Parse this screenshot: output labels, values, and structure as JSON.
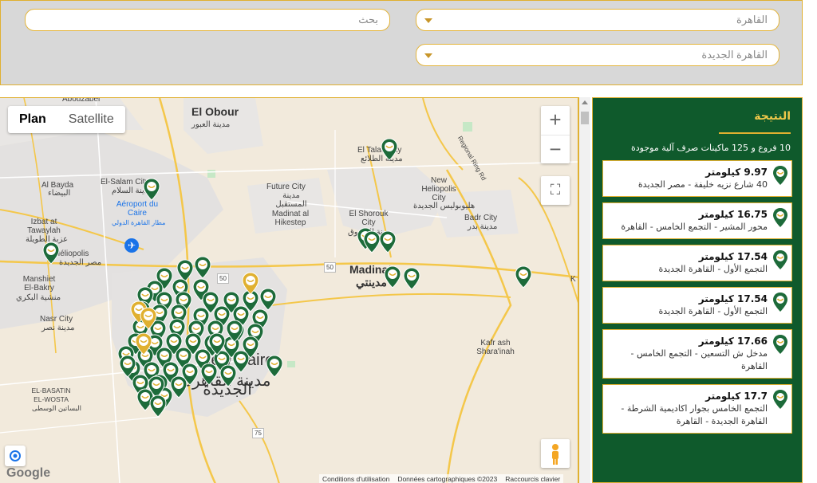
{
  "filters": {
    "search_placeholder": "بحث",
    "city_value": "القاهرة",
    "district_value": "القاهرة الجديدة"
  },
  "map": {
    "plan_label": "Plan",
    "satellite_label": "Satellite",
    "zoom_in": "+",
    "zoom_out": "−",
    "fullscreen_icon": "⛶",
    "logo": "Google",
    "attribution": [
      "Conditions d'utilisation",
      "Données cartographiques ©2023",
      "Raccourcis clavier"
    ],
    "labels": {
      "abouzabel": "Abouzabel",
      "el_obour": "El Obour",
      "el_obour_ar": "مدينة العبور",
      "el_talae": "El Talae City",
      "el_talae_ar": "مدينة الطلائع",
      "al_bayda": "Al Bayda",
      "al_bayda_ar": "البيضاء",
      "el_salam": "El-Salam City",
      "el_salam_ar": "مدينة السلام",
      "aeroport": "Aéroport du Caire",
      "aeroport_ar": "مطار القاهرة الدولي",
      "future_city": "Future City",
      "future_city_ar": "مدينة المستقبل",
      "madinat_hikestep": "Madinat al Hikestep",
      "new_heliopolis": "New Heliopolis City",
      "new_heliopolis_ar": "هليوبوليس الجديدة",
      "regional_ring": "Regional Ring Rd",
      "izbat": "Izbat at Tawaylah",
      "izbat_ar": "عزبة الطويلة",
      "heliopolis": "Héliopolis",
      "heliopolis_ar": "مصر الجديدة",
      "el_shorouk": "El Shorouk City",
      "el_shorouk_ar": "مدينة الشروق",
      "badr": "Badr City",
      "badr_ar": "مدينة بدر",
      "manshiet": "Manshiet El-Bakry",
      "manshiet_ar": "منشية البكري",
      "madinaty": "Madinaty",
      "madinaty_ar": "مدينتي",
      "nasr": "Nasr City",
      "nasr_ar": "مدينة نصر",
      "kafr": "Kafr ash Shara'inah",
      "el_basatin": "EL-BASATIN EL-WOSTA",
      "el_basatin_ar": "البساتين الوسطى",
      "new_cairo": "New Cairo",
      "new_cairo_ar": "مدينة القاهرة الجديدة",
      "k_label": "K",
      "route50a": "50",
      "route50b": "50",
      "route75": "75"
    }
  },
  "result": {
    "title": "النتيجة",
    "count_text": "10 فروع و 125 ماكينات صرف آلية موجودة",
    "items": [
      {
        "distance": "9.97 كيلومتر",
        "address": "40 شارع نزيه خليفة - مصر الجديدة"
      },
      {
        "distance": "16.75 كيلومتر",
        "address": "محور المشير - التجمع الخامس - القاهرة"
      },
      {
        "distance": "17.54 كيلومتر",
        "address": "التجمع الأول - القاهرة الجديدة"
      },
      {
        "distance": "17.54 كيلومتر",
        "address": "التجمع الأول - القاهرة الجديدة"
      },
      {
        "distance": "17.66 كيلومتر",
        "address": "مدخل ش التسعين - التجمع الخامس - القاهرة"
      },
      {
        "distance": "17.7 كيلومتر",
        "address": "التجمع الخامس بجوار اكاديمية الشرطة - القاهرة الجديدة - القاهرة"
      }
    ]
  },
  "colors": {
    "brand_green": "#0f5a2c",
    "accent_gold": "#e0b030",
    "pin_green": "#1d6b3a"
  }
}
